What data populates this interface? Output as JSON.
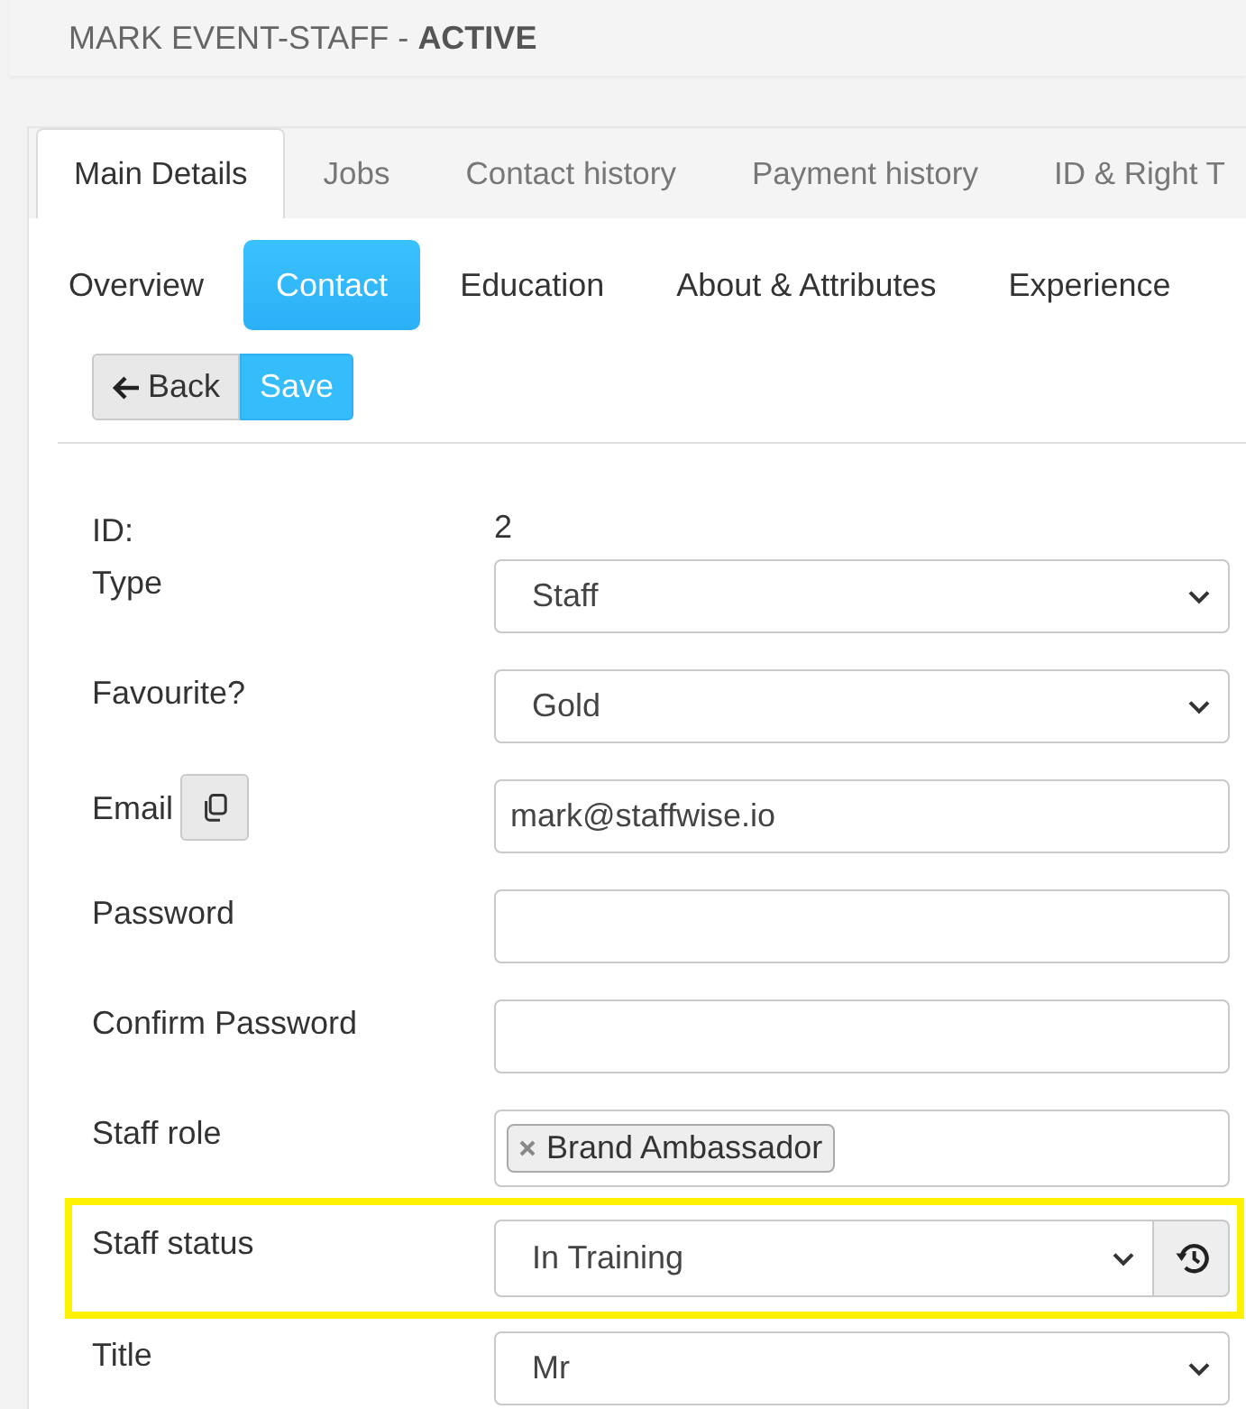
{
  "header": {
    "title": "MARK EVENT-STAFF - **ACTIVE**"
  },
  "tabs": [
    {
      "label": "Main Details",
      "selected": true
    },
    {
      "label": "Jobs",
      "selected": false
    },
    {
      "label": "Contact history",
      "selected": false
    },
    {
      "label": "Payment history",
      "selected": false
    },
    {
      "label": "ID & Right T",
      "selected": false
    }
  ],
  "subtabs": [
    {
      "label": "Overview",
      "selected": false
    },
    {
      "label": "Contact",
      "selected": true
    },
    {
      "label": "Education",
      "selected": false
    },
    {
      "label": "About & Attributes",
      "selected": false
    },
    {
      "label": "Experience",
      "selected": false
    }
  ],
  "actions": [
    {
      "kind": "back",
      "label": "Back"
    },
    {
      "kind": "primary",
      "label": "Save"
    }
  ],
  "form": {
    "fields": [
      {
        "label": "ID:",
        "kind": "static",
        "value": "2",
        "highlighted": false
      },
      {
        "label": "Type",
        "kind": "select",
        "value": "Staff",
        "highlighted": false
      },
      {
        "label": "Favourite?",
        "kind": "select",
        "value": "Gold",
        "highlighted": false
      },
      {
        "label": "Email",
        "kind": "text",
        "value": "mark@staffwise.io",
        "copy_button": true,
        "highlighted": false
      },
      {
        "label": "Password",
        "kind": "password",
        "highlighted": false
      },
      {
        "label": "Confirm Password",
        "kind": "password",
        "highlighted": false
      },
      {
        "label": "Staff role",
        "kind": "tags",
        "tags": [
          "Brand Ambassador"
        ],
        "highlighted": false
      },
      {
        "label": "Staff status",
        "kind": "select",
        "value": "In Training",
        "history_button": true,
        "highlighted": true
      },
      {
        "label": "Title",
        "kind": "select",
        "value": "Mr",
        "highlighted": false
      }
    ]
  }
}
